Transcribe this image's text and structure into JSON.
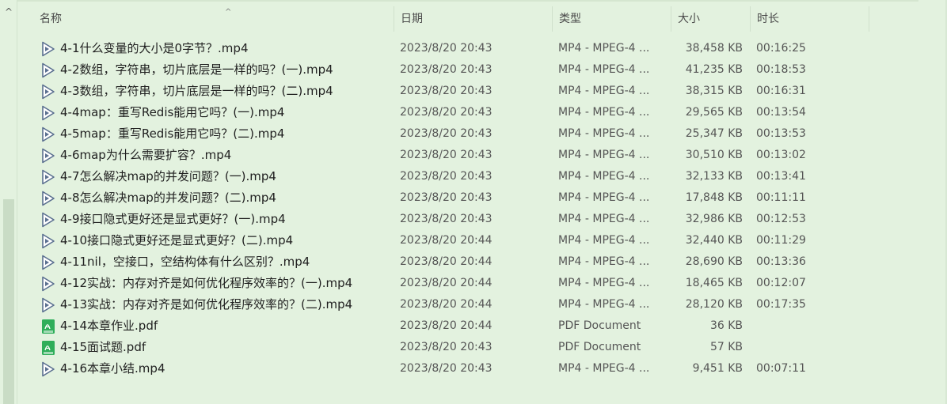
{
  "header": {
    "name": "名称",
    "date": "日期",
    "type": "类型",
    "size": "大小",
    "duration": "时长"
  },
  "files": [
    {
      "name": "4-1什么变量的大小是0字节？.mp4",
      "date": "2023/8/20 20:43",
      "type": "MP4 - MPEG-4 ...",
      "size": "38,458 KB",
      "duration": "00:16:25",
      "icon": "video-file-icon"
    },
    {
      "name": "4-2数组，字符串，切片底层是一样的吗？(一).mp4",
      "date": "2023/8/20 20:43",
      "type": "MP4 - MPEG-4 ...",
      "size": "41,235 KB",
      "duration": "00:18:53",
      "icon": "video-file-icon"
    },
    {
      "name": "4-3数组，字符串，切片底层是一样的吗？(二).mp4",
      "date": "2023/8/20 20:43",
      "type": "MP4 - MPEG-4 ...",
      "size": "38,315 KB",
      "duration": "00:16:31",
      "icon": "video-file-icon"
    },
    {
      "name": "4-4map：重写Redis能用它吗？(一).mp4",
      "date": "2023/8/20 20:43",
      "type": "MP4 - MPEG-4 ...",
      "size": "29,565 KB",
      "duration": "00:13:54",
      "icon": "video-file-icon"
    },
    {
      "name": "4-5map：重写Redis能用它吗？(二).mp4",
      "date": "2023/8/20 20:43",
      "type": "MP4 - MPEG-4 ...",
      "size": "25,347 KB",
      "duration": "00:13:53",
      "icon": "video-file-icon"
    },
    {
      "name": "4-6map为什么需要扩容？.mp4",
      "date": "2023/8/20 20:43",
      "type": "MP4 - MPEG-4 ...",
      "size": "30,510 KB",
      "duration": "00:13:02",
      "icon": "video-file-icon"
    },
    {
      "name": "4-7怎么解决map的并发问题？(一).mp4",
      "date": "2023/8/20 20:43",
      "type": "MP4 - MPEG-4 ...",
      "size": "32,133 KB",
      "duration": "00:13:41",
      "icon": "video-file-icon"
    },
    {
      "name": "4-8怎么解决map的并发问题？(二).mp4",
      "date": "2023/8/20 20:43",
      "type": "MP4 - MPEG-4 ...",
      "size": "17,848 KB",
      "duration": "00:11:11",
      "icon": "video-file-icon"
    },
    {
      "name": "4-9接口隐式更好还是显式更好？(一).mp4",
      "date": "2023/8/20 20:43",
      "type": "MP4 - MPEG-4 ...",
      "size": "32,986 KB",
      "duration": "00:12:53",
      "icon": "video-file-icon"
    },
    {
      "name": "4-10接口隐式更好还是显式更好？(二).mp4",
      "date": "2023/8/20 20:44",
      "type": "MP4 - MPEG-4 ...",
      "size": "32,440 KB",
      "duration": "00:11:29",
      "icon": "video-file-icon"
    },
    {
      "name": "4-11nil，空接口，空结构体有什么区别？.mp4",
      "date": "2023/8/20 20:44",
      "type": "MP4 - MPEG-4 ...",
      "size": "28,690 KB",
      "duration": "00:13:36",
      "icon": "video-file-icon"
    },
    {
      "name": "4-12实战：内存对齐是如何优化程序效率的？(一).mp4",
      "date": "2023/8/20 20:44",
      "type": "MP4 - MPEG-4 ...",
      "size": "18,465 KB",
      "duration": "00:12:07",
      "icon": "video-file-icon"
    },
    {
      "name": "4-13实战：内存对齐是如何优化程序效率的？(二).mp4",
      "date": "2023/8/20 20:44",
      "type": "MP4 - MPEG-4 ...",
      "size": "28,120 KB",
      "duration": "00:17:35",
      "icon": "video-file-icon"
    },
    {
      "name": "4-14本章作业.pdf",
      "date": "2023/8/20 20:44",
      "type": "PDF Document",
      "size": "36 KB",
      "duration": "",
      "icon": "pdf-file-icon"
    },
    {
      "name": "4-15面试题.pdf",
      "date": "2023/8/20 20:43",
      "type": "PDF Document",
      "size": "57 KB",
      "duration": "",
      "icon": "pdf-file-icon"
    },
    {
      "name": "4-16本章小结.mp4",
      "date": "2023/8/20 20:43",
      "type": "MP4 - MPEG-4 ...",
      "size": "9,451 KB",
      "duration": "00:07:11",
      "icon": "video-file-icon"
    }
  ]
}
